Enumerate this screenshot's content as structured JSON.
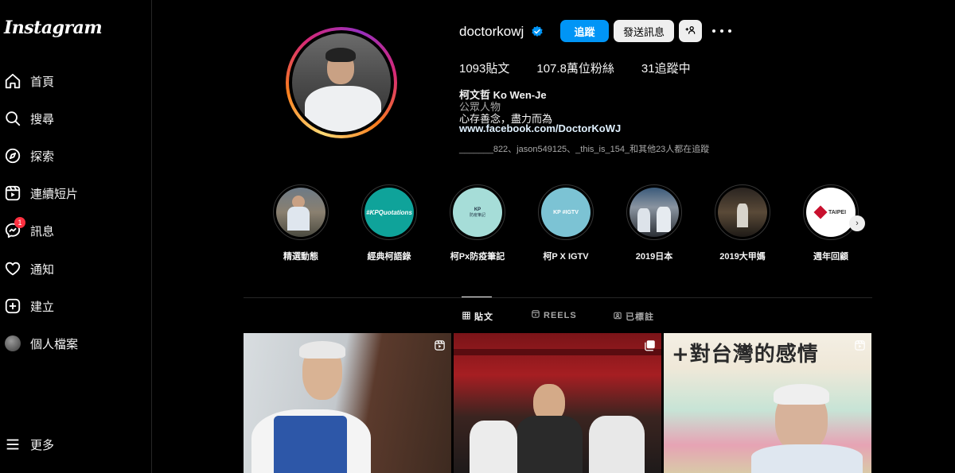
{
  "app": {
    "logo": "Instagram"
  },
  "sidebar": {
    "items": [
      {
        "label": "首頁",
        "icon": "home-icon"
      },
      {
        "label": "搜尋",
        "icon": "search-icon"
      },
      {
        "label": "探索",
        "icon": "compass-icon"
      },
      {
        "label": "連續短片",
        "icon": "reels-icon"
      },
      {
        "label": "訊息",
        "icon": "messenger-icon",
        "badge": "1"
      },
      {
        "label": "通知",
        "icon": "heart-icon"
      },
      {
        "label": "建立",
        "icon": "plus-square-icon"
      },
      {
        "label": "個人檔案",
        "icon": "avatar"
      }
    ],
    "more": {
      "label": "更多",
      "icon": "hamburger-icon"
    }
  },
  "profile": {
    "username": "doctorkowj",
    "verified": true,
    "buttons": {
      "follow": "追蹤",
      "message": "發送訊息",
      "add_user_icon": "add-user-icon",
      "more_icon": "more-icon"
    },
    "stats": {
      "posts": "1093貼文",
      "followers": "107.8萬位粉絲",
      "following": "31追蹤中"
    },
    "bio": {
      "name": "柯文哲 Ko Wen-Je",
      "category": "公眾人物",
      "text": "心存善念，盡力而為",
      "link": "www.facebook.com/DoctorKoWJ"
    },
    "followed_by": "_______822、jason549125、_this_is_154_和其他23人都在追蹤"
  },
  "highlights": [
    {
      "label": "精選動態"
    },
    {
      "label": "經典柯語錄",
      "cover_text": "#KPQuotations"
    },
    {
      "label": "柯Px防疫筆記",
      "cover_text": "KP",
      "cover_sub": "防疫筆記"
    },
    {
      "label": "柯P X IGTV",
      "cover_text": "KP #IGTV"
    },
    {
      "label": "2019日本"
    },
    {
      "label": "2019大甲媽"
    },
    {
      "label": "週年回顧",
      "cover_text": "TAIPEI"
    }
  ],
  "tabs": [
    {
      "label": "貼文",
      "icon": "grid-icon",
      "active": true
    },
    {
      "label": "REELS",
      "icon": "reels-icon"
    },
    {
      "label": "已標註",
      "icon": "tagged-icon"
    }
  ],
  "posts": [
    {
      "type": "reel",
      "overlay_text": ""
    },
    {
      "type": "carousel",
      "overlay_text": ""
    },
    {
      "type": "reel",
      "overlay_text": "+對台灣的感情"
    }
  ],
  "colors": {
    "accent": "#0095f6",
    "background": "#000000",
    "badge": "#ff3040"
  }
}
